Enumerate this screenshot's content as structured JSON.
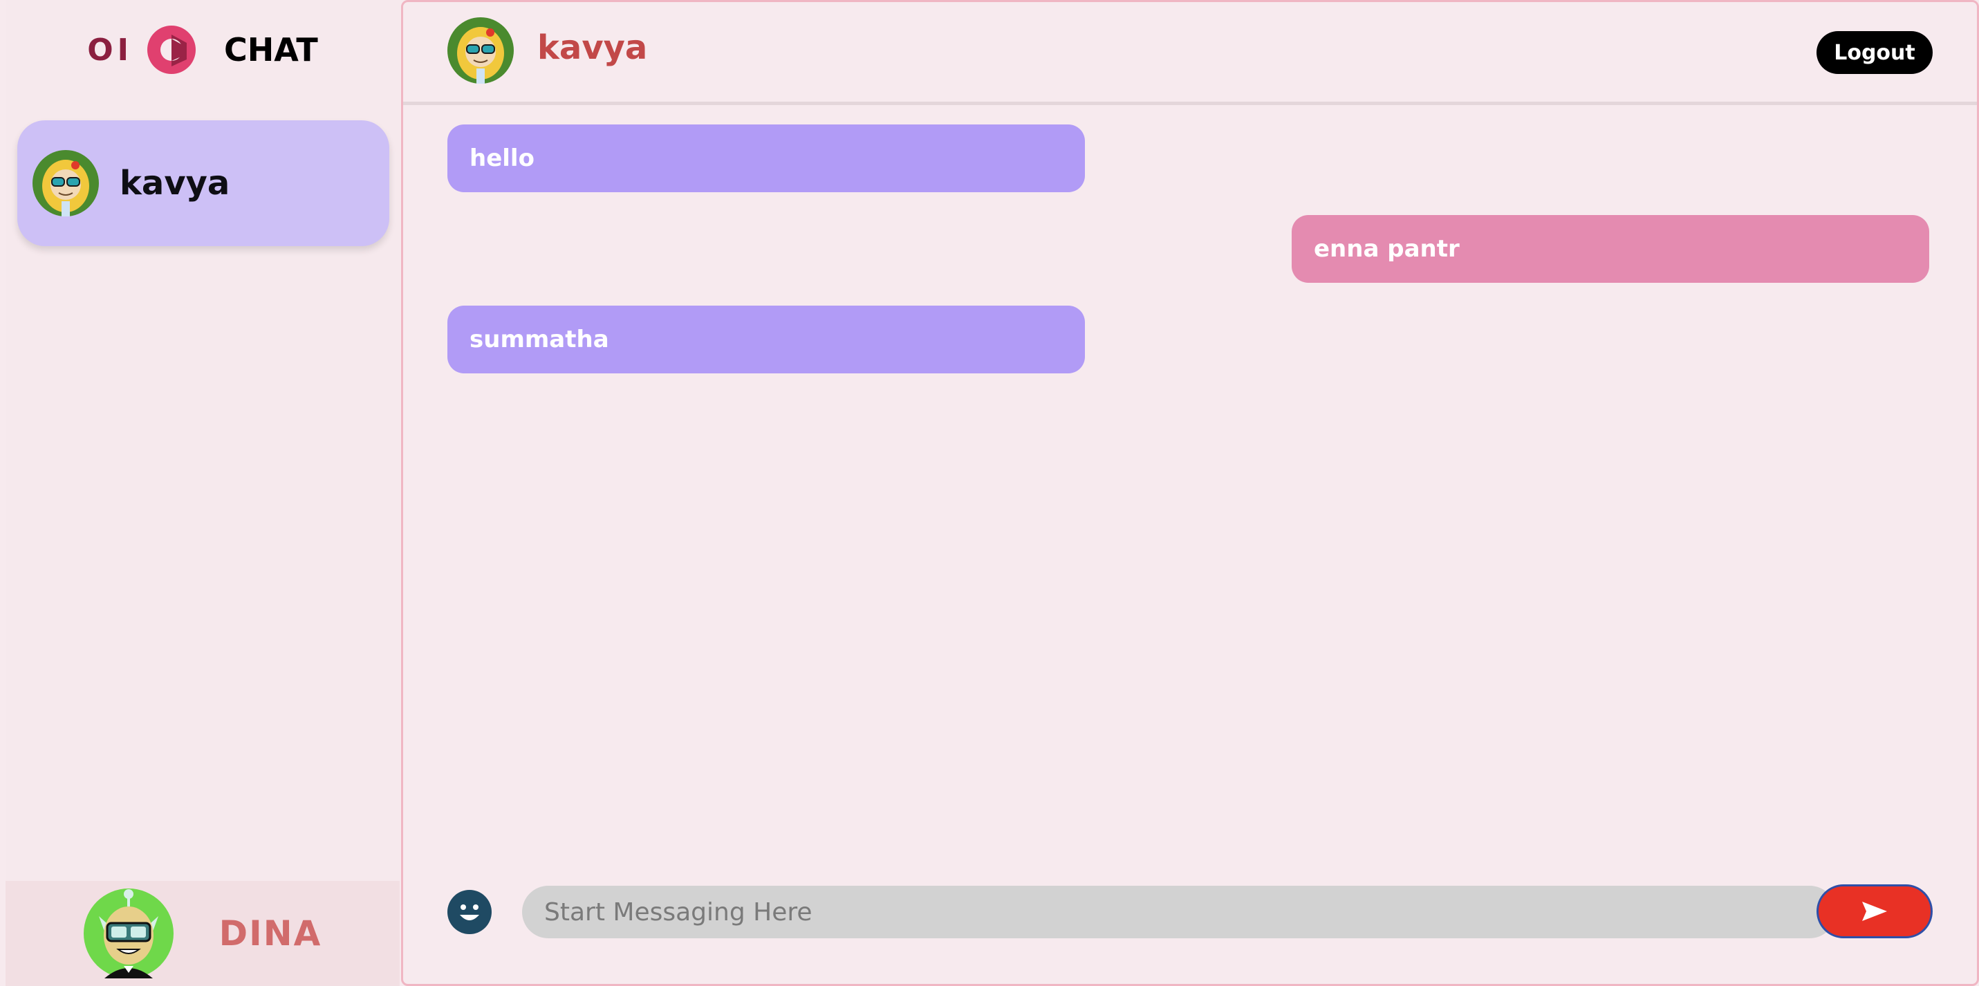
{
  "brand": {
    "prefix": "OI",
    "name": "CHAT",
    "logo_icon": "chat-logo-icon"
  },
  "sidebar": {
    "contacts": [
      {
        "name": "kavya",
        "avatar_icon": "avatar-girl-icon"
      }
    ],
    "current_user": {
      "name": "DINA",
      "avatar_icon": "avatar-alien-icon"
    }
  },
  "chat": {
    "contact_name": "kavya",
    "logout_label": "Logout",
    "messages": [
      {
        "text": "hello",
        "direction": "incoming"
      },
      {
        "text": "enna pantr",
        "direction": "outgoing"
      },
      {
        "text": "summatha",
        "direction": "incoming"
      }
    ],
    "input": {
      "placeholder": "Start Messaging Here",
      "value": ""
    },
    "send_icon": "send-icon",
    "emoji_icon": "emoji-icon"
  },
  "colors": {
    "incoming_bubble": "#b19bf6",
    "outgoing_bubble": "#e48bb0",
    "selected_contact": "#cdc0f6",
    "send_button": "#e83125",
    "header_name": "#c24848",
    "user_name": "#d16b6b"
  }
}
